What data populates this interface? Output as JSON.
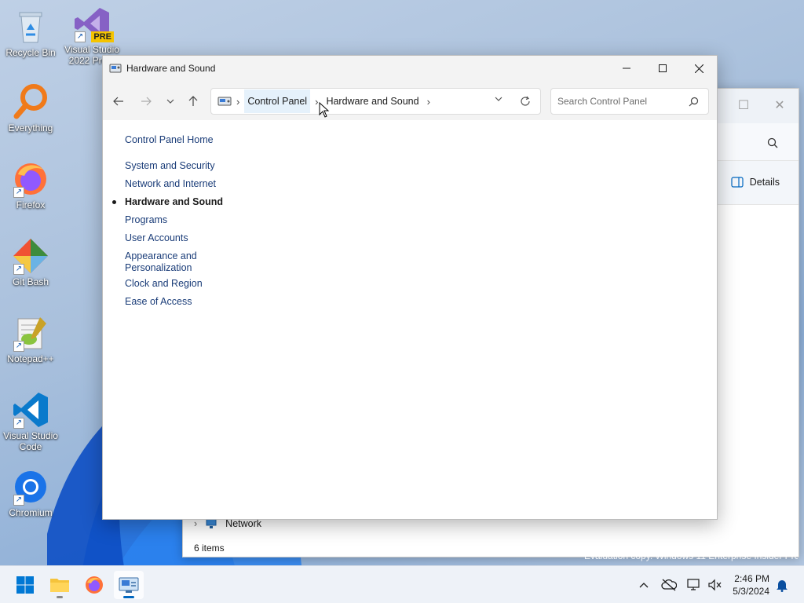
{
  "desktop": {
    "icons": [
      {
        "label": "Recycle Bin",
        "icon": "recycle-bin-icon"
      },
      {
        "label": "Visual Studio 2022 Pre...",
        "icon": "visual-studio-icon",
        "badge": "PRE"
      },
      {
        "label": "Everything",
        "icon": "everything-search-icon"
      },
      {
        "label": "Firefox",
        "icon": "firefox-icon"
      },
      {
        "label": "Git Bash",
        "icon": "git-bash-icon"
      },
      {
        "label": "Notepad++",
        "icon": "notepad-plus-plus-icon"
      },
      {
        "label": "Visual Studio Code",
        "icon": "vscode-icon"
      },
      {
        "label": "Chromium",
        "icon": "chromium-icon"
      }
    ]
  },
  "background_window": {
    "details_label": "Details",
    "network_label": "Network",
    "status": "6 items"
  },
  "watermark": "Evaluation copy. Windows 11 Enterprise Insider Preview",
  "window": {
    "title": "Hardware and Sound",
    "breadcrumb": [
      "Control Panel",
      "Hardware and Sound"
    ],
    "search_placeholder": "Search Control Panel",
    "side_nav": {
      "home": "Control Panel Home",
      "items": [
        {
          "label": "System and Security"
        },
        {
          "label": "Network and Internet"
        },
        {
          "label": "Hardware and Sound",
          "active": true
        },
        {
          "label": "Programs"
        },
        {
          "label": "User Accounts"
        },
        {
          "label": "Appearance and Personalization"
        },
        {
          "label": "Clock and Region"
        },
        {
          "label": "Ease of Access"
        }
      ]
    }
  },
  "taskbar": {
    "apps": [
      "start-icon",
      "file-explorer-icon",
      "firefox-icon",
      "control-panel-icon"
    ],
    "time": "2:46 PM",
    "date": "5/3/2024"
  },
  "colors": {
    "accent": "#0067c0",
    "link": "#1a3c78",
    "titlebar": "#f3f3f3"
  }
}
